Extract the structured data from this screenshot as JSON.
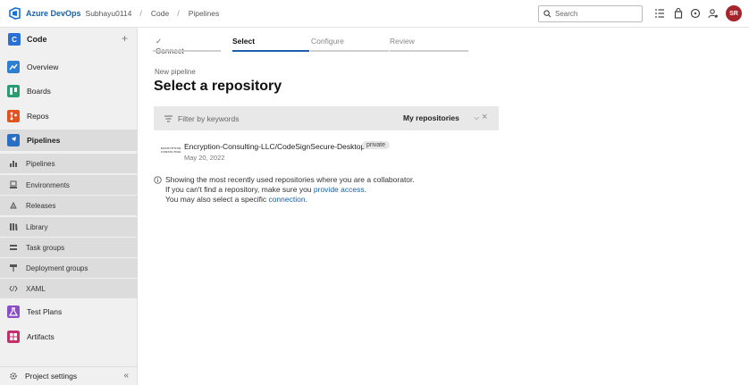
{
  "topbar": {
    "brand": "Azure DevOps",
    "breadcrumb": [
      "Subhayu0114",
      "Code",
      "Pipelines"
    ],
    "search_placeholder": "Search",
    "avatar_initials": "SR"
  },
  "sidebar": {
    "project_initial": "C",
    "project_name": "Code",
    "items": [
      {
        "label": "Overview",
        "color": "#2f7fd0"
      },
      {
        "label": "Boards",
        "color": "#2a9d6e"
      },
      {
        "label": "Repos",
        "color": "#e0531e"
      },
      {
        "label": "Pipelines",
        "color": "#2b6fc4"
      },
      {
        "label": "Test Plans",
        "color": "#8a4fc7"
      },
      {
        "label": "Artifacts",
        "color": "#c3306b"
      }
    ],
    "pipeline_subitems": [
      "Pipelines",
      "Environments",
      "Releases",
      "Library",
      "Task groups",
      "Deployment groups",
      "XAML"
    ],
    "settings_label": "Project settings",
    "collapse_glyph": "«"
  },
  "wizard": {
    "steps": [
      {
        "label": "Connect",
        "state": "done"
      },
      {
        "label": "Select",
        "state": "current"
      },
      {
        "label": "Configure",
        "state": "todo"
      },
      {
        "label": "Review",
        "state": "todo"
      }
    ],
    "accent": "#1a5fa8"
  },
  "page": {
    "subtitle": "New pipeline",
    "title": "Select a repository"
  },
  "filter": {
    "placeholder": "Filter by keywords",
    "scope": "My repositories"
  },
  "repo": {
    "org_logo_text": "ENCRYPTION CONSULTING",
    "name": "Encryption-Consulting-LLC/CodeSignSecure-Desktop",
    "visibility": "private",
    "date": "May 20, 2022"
  },
  "info": {
    "line1": "Showing the most recently used repositories where you are a collaborator.",
    "line2_prefix": "If you can't find a repository, make sure you ",
    "line2_link": "provide access",
    "line2_suffix": ".",
    "line3_prefix": "You may also select a specific ",
    "line3_link": "connection",
    "line3_suffix": "."
  }
}
